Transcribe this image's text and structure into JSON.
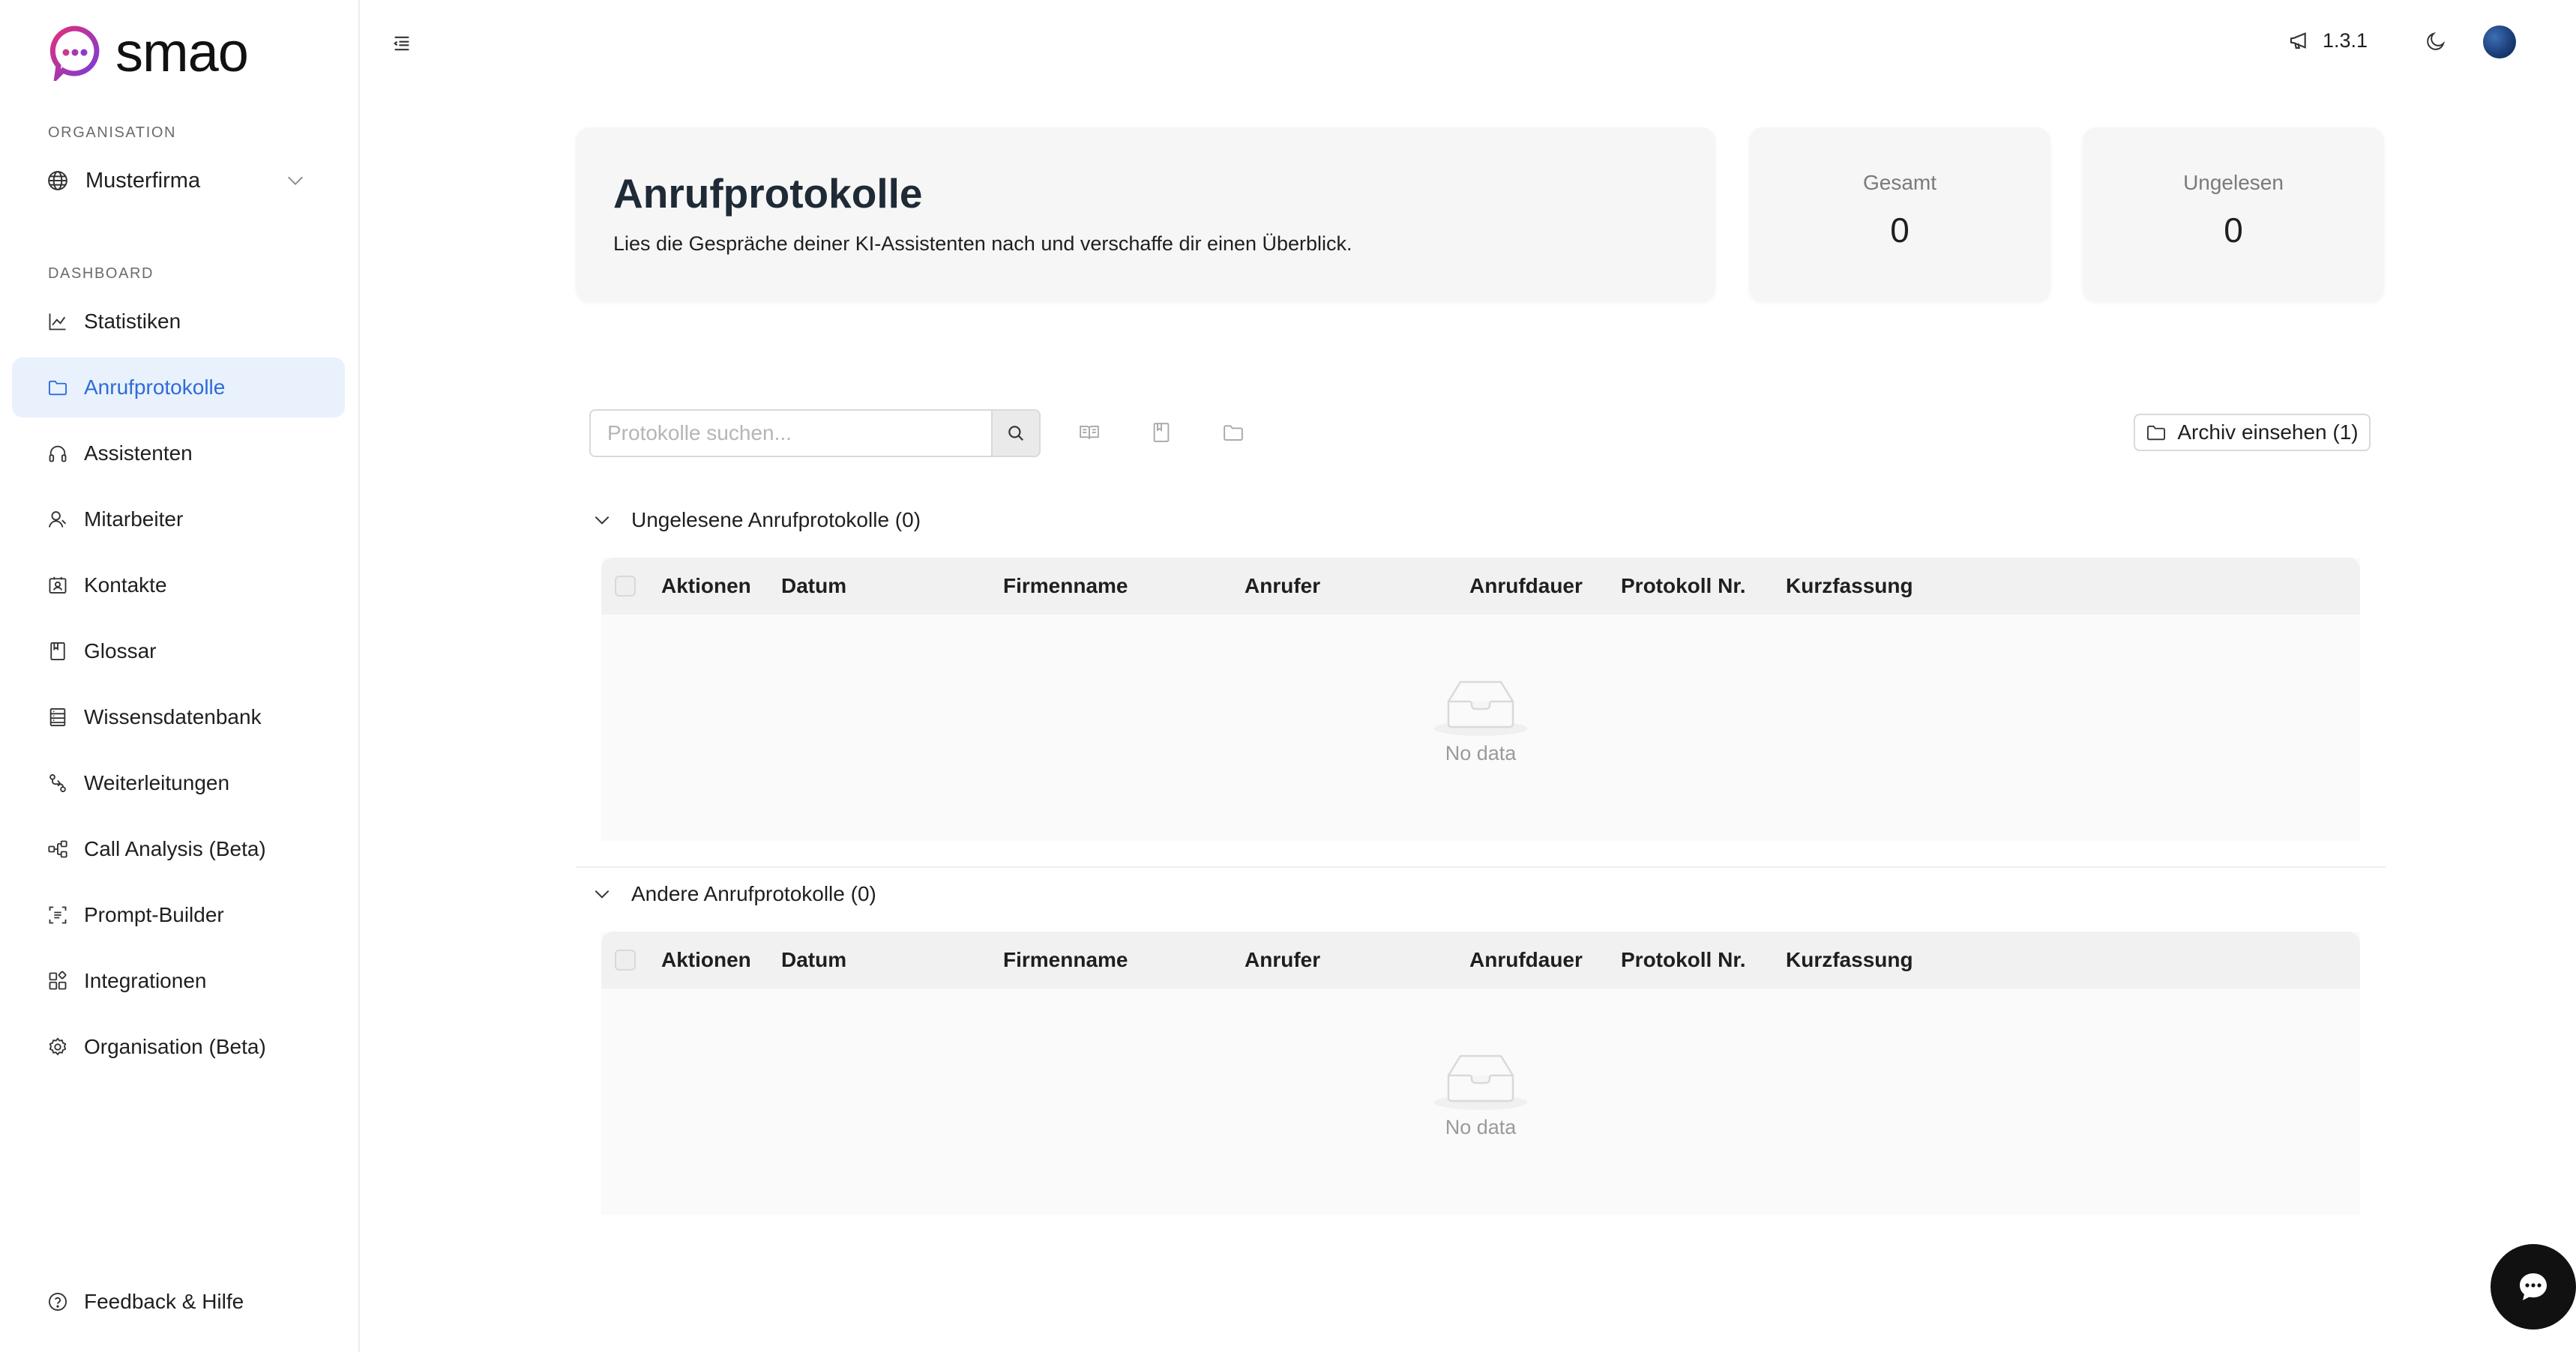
{
  "app": {
    "logo_text": "smao"
  },
  "sidebar": {
    "org_label": "ORGANISATION",
    "org_value": "Musterfirma",
    "dashboard_label": "DASHBOARD",
    "items": [
      {
        "label": "Statistiken",
        "icon": "chart-line-icon"
      },
      {
        "label": "Anrufprotokolle",
        "icon": "folder-icon",
        "active": true
      },
      {
        "label": "Assistenten",
        "icon": "headphones-icon"
      },
      {
        "label": "Mitarbeiter",
        "icon": "user-icon"
      },
      {
        "label": "Kontakte",
        "icon": "contacts-icon"
      },
      {
        "label": "Glossar",
        "icon": "book-icon"
      },
      {
        "label": "Wissensdatenbank",
        "icon": "database-icon"
      },
      {
        "label": "Weiterleitungen",
        "icon": "forward-icon"
      },
      {
        "label": "Call Analysis (Beta)",
        "icon": "analysis-icon"
      },
      {
        "label": "Prompt-Builder",
        "icon": "builder-icon"
      },
      {
        "label": "Integrationen",
        "icon": "integrations-icon"
      },
      {
        "label": "Organisation (Beta)",
        "icon": "gear-icon"
      }
    ],
    "footer_label": "Feedback & Hilfe"
  },
  "header": {
    "version": "1.3.1"
  },
  "page": {
    "title": "Anrufprotokolle",
    "description": "Lies die Gespräche deiner KI-Assistenten nach und verschaffe dir einen Überblick.",
    "stats": [
      {
        "label": "Gesamt",
        "value": "0"
      },
      {
        "label": "Ungelesen",
        "value": "0"
      }
    ]
  },
  "toolbar": {
    "search_placeholder": "Protokolle suchen...",
    "archive_label": "Archiv einsehen (1)"
  },
  "sections": [
    {
      "title": "Ungelesene Anrufprotokolle (0)",
      "empty_text": "No data"
    },
    {
      "title": "Andere Anrufprotokolle (0)",
      "empty_text": "No data"
    }
  ],
  "table": {
    "columns": [
      "Aktionen",
      "Datum",
      "Firmenname",
      "Anrufer",
      "Anrufdauer",
      "Protokoll Nr.",
      "Kurzfassung"
    ]
  },
  "colors": {
    "accent": "#2f6bd8",
    "active_bg": "#e8f1fc",
    "logo_gradient": [
      "#e0307a",
      "#7a3bd8"
    ]
  }
}
